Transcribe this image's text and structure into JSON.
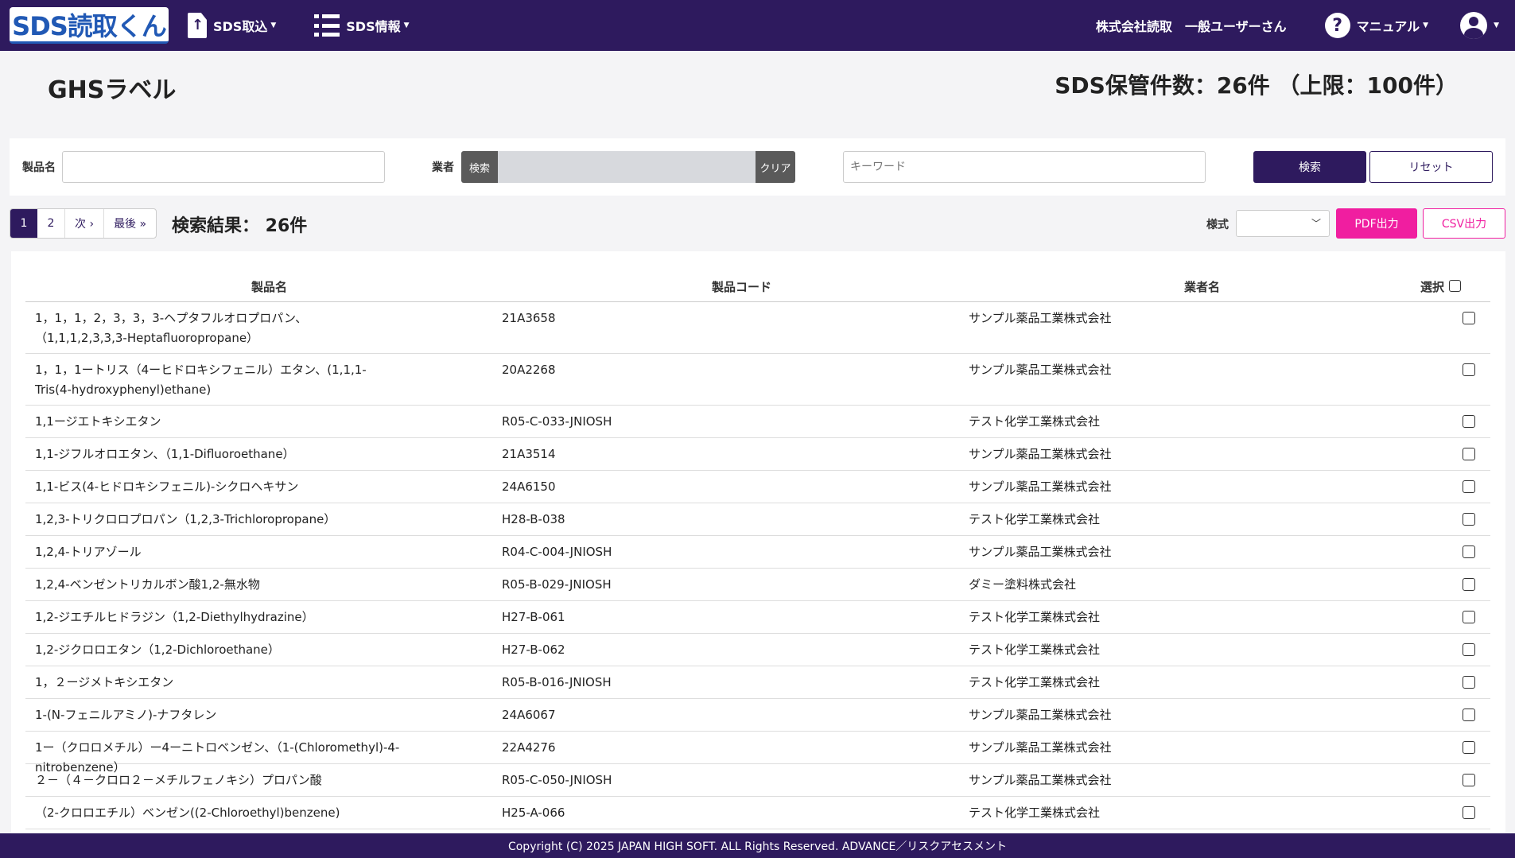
{
  "navbar": {
    "logo": "SDS読取くん",
    "sds_import": "SDS取込",
    "sds_info": "SDS情報",
    "company": "株式会社読取",
    "user": "一般ユーザーさん",
    "manual": "マニュアル",
    "accent_color": "#2e1a5e"
  },
  "header": {
    "title": "GHSラベル",
    "storage_count": "SDS保管件数：26件 （上限：100件）"
  },
  "search": {
    "product_label": "製品名",
    "product_value": "",
    "vendor_label": "業者",
    "vendor_search_button": "検索",
    "vendor_clear_button": "クリア",
    "keyword_placeholder": "キーワード",
    "search_button": "検索",
    "reset_button": "リセット"
  },
  "pagination": {
    "pages": [
      "1",
      "2"
    ],
    "active_page": "1",
    "next": "次 ›",
    "last": "最後 »"
  },
  "results": {
    "count_text": "検索結果： 26件"
  },
  "export": {
    "format_label": "様式",
    "format_value": "",
    "pdf_button": "PDF出力",
    "csv_button": "CSV出力",
    "pdf_color": "#f01ea0"
  },
  "table": {
    "headers": {
      "name": "製品名",
      "code": "製品コード",
      "vendor": "業者名",
      "select": "選択"
    },
    "rows": [
      {
        "name": "1，1，1，2，3，3，3-ヘプタフルオロプロパン、（1,1,1,2,3,3,3-Heptafluoropropane）",
        "code": "21A3658",
        "vendor": "サンプル薬品工業株式会社"
      },
      {
        "name": "1，1，1ートリス（4ーヒドロキシフェニル）エタン、(1,1,1-Tris(4-hydroxyphenyl)ethane)",
        "code": "20A2268",
        "vendor": "サンプル薬品工業株式会社"
      },
      {
        "name": "1,1ージエトキシエタン",
        "code": "R05-C-033-JNIOSH",
        "vendor": "テスト化学工業株式会社"
      },
      {
        "name": "1,1-ジフルオロエタン、（1,1-Difluoroethane）",
        "code": "21A3514",
        "vendor": "サンプル薬品工業株式会社"
      },
      {
        "name": "1,1-ビス(4-ヒドロキシフェニル)-シクロヘキサン",
        "code": "24A6150",
        "vendor": "サンプル薬品工業株式会社"
      },
      {
        "name": "1,2,3-トリクロロプロパン（1,2,3-Trichloropropane）",
        "code": "H28-B-038",
        "vendor": "テスト化学工業株式会社"
      },
      {
        "name": "1,2,4-トリアゾール",
        "code": "R04-C-004-JNIOSH",
        "vendor": "サンプル薬品工業株式会社"
      },
      {
        "name": "1,2,4-ベンゼントリカルボン酸1,2-無水物",
        "code": "R05-B-029-JNIOSH",
        "vendor": "ダミー塗料株式会社"
      },
      {
        "name": "1,2-ジエチルヒドラジン（1,2-Diethylhydrazine）",
        "code": "H27-B-061",
        "vendor": "テスト化学工業株式会社"
      },
      {
        "name": "1,2-ジクロロエタン（1,2-Dichloroethane）",
        "code": "H27-B-062",
        "vendor": "テスト化学工業株式会社"
      },
      {
        "name": "1，２ージメトキシエタン",
        "code": "R05-B-016-JNIOSH",
        "vendor": "テスト化学工業株式会社"
      },
      {
        "name": "1-(N-フェニルアミノ)-ナフタレン",
        "code": "24A6067",
        "vendor": "サンプル薬品工業株式会社"
      },
      {
        "name": "1ー（クロロメチル）ー4ーニトロベンゼン、（1-(Chloromethyl)-4-nitrobenzene）",
        "code": "22A4276",
        "vendor": "サンプル薬品工業株式会社"
      },
      {
        "name": "２－（４－クロロ２－メチルフェノキシ）プロパン酸",
        "code": "R05-C-050-JNIOSH",
        "vendor": "サンプル薬品工業株式会社"
      },
      {
        "name": "（2-クロロエチル）ベンゼン((2-Chloroethyl)benzene)",
        "code": "H25-A-066",
        "vendor": "テスト化学工業株式会社"
      }
    ]
  },
  "footer": {
    "copyright": "Copyright (C) 2025 JAPAN HIGH SOFT. ALL Rights Reserved. ADVANCE／リスクアセスメント"
  }
}
